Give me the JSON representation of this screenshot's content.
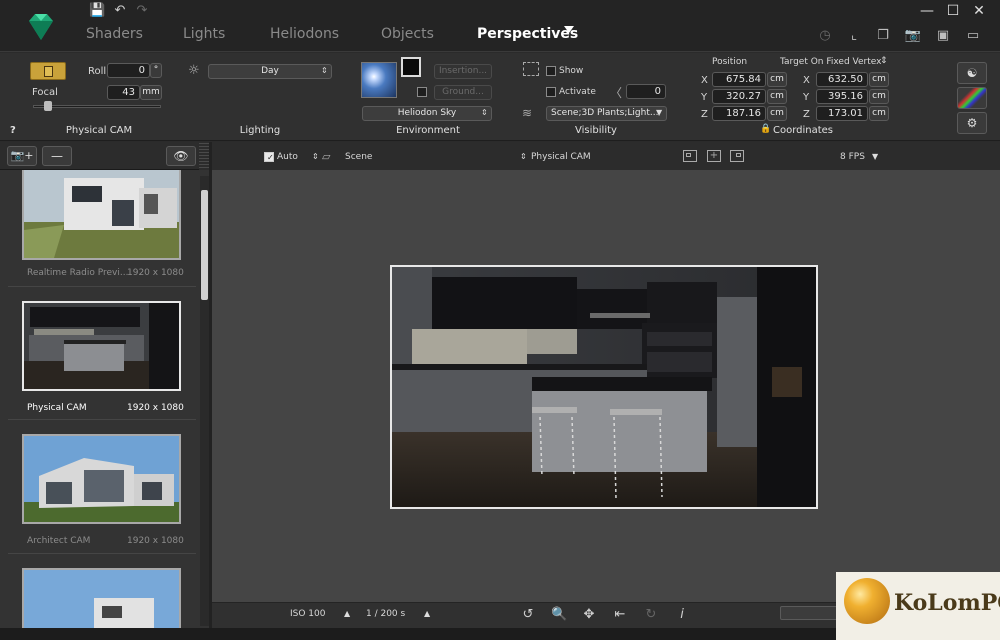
{
  "tabs": [
    {
      "label": "Shaders"
    },
    {
      "label": "Lights"
    },
    {
      "label": "Heliodons"
    },
    {
      "label": "Objects"
    },
    {
      "label": "Perspectives"
    }
  ],
  "camera": {
    "roll_label": "Roll",
    "roll_value": "0",
    "roll_unit": "°",
    "focal_label": "Focal",
    "focal_value": "43",
    "focal_unit": "mm",
    "section": "Physical CAM",
    "help": "?"
  },
  "lighting": {
    "preset": "Day",
    "section": "Lighting"
  },
  "environment": {
    "insertion_button": "Insertion...",
    "ground_button": "Ground...",
    "sky": "Heliodon Sky",
    "section": "Environment"
  },
  "visibility": {
    "show_label": "Show",
    "activate_label": "Activate",
    "activate_value": "0",
    "scene_filter": "Scene;3D Plants;Light...",
    "section": "Visibility"
  },
  "coordinates": {
    "position_label": "Position",
    "target_label": "Target On Fixed Vertex",
    "position": [
      {
        "axis": "X",
        "value": "675.84",
        "unit": "cm"
      },
      {
        "axis": "Y",
        "value": "320.27",
        "unit": "cm"
      },
      {
        "axis": "Z",
        "value": "187.16",
        "unit": "cm"
      }
    ],
    "target": [
      {
        "axis": "X",
        "value": "632.50",
        "unit": "cm"
      },
      {
        "axis": "Y",
        "value": "395.16",
        "unit": "cm"
      },
      {
        "axis": "Z",
        "value": "173.01",
        "unit": "cm"
      }
    ],
    "section": "Coordinates"
  },
  "viewport_bar": {
    "auto_label": "Auto",
    "scene_label": "Scene",
    "camera_label": "Physical CAM",
    "fps": "8 FPS"
  },
  "cameras": [
    {
      "name": "Realtime Radio Previ...",
      "resolution": "1920 x 1080",
      "selected": false
    },
    {
      "name": "Physical CAM",
      "resolution": "1920 x 1080",
      "selected": true
    },
    {
      "name": "Architect CAM",
      "resolution": "1920 x 1080",
      "selected": false
    }
  ],
  "bottom": {
    "iso": "ISO  100",
    "shutter": "1 / 200 s"
  },
  "watermark": "KoLomPC",
  "colors": {
    "brand": "#2ecc8f",
    "background": "#2b2b2b",
    "viewport": "#454545"
  }
}
